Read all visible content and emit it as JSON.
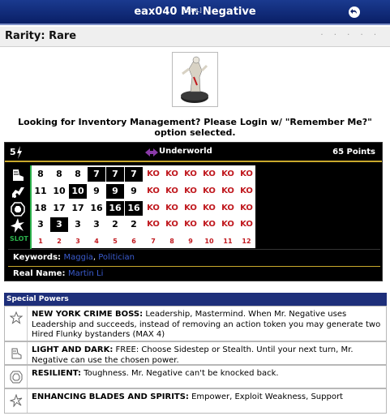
{
  "header": {
    "title": "eax040 Mr. Negative",
    "dial_label": "[DIAL]"
  },
  "rarity": {
    "text": "Rarity: Rare",
    "dots": "· · · · ·"
  },
  "notice": "Looking for Inventory Management? Please Login w/ \"Remember Me?\" option selected.",
  "card": {
    "point_prefix": "5",
    "team": "Underworld",
    "points": "65 Points",
    "dial_rows": [
      {
        "stat": "speed",
        "values": [
          "8",
          "8",
          "8",
          "7",
          "7",
          "7",
          "KO",
          "KO",
          "KO",
          "KO",
          "KO",
          "KO"
        ],
        "dark": [
          false,
          false,
          false,
          true,
          true,
          true,
          false,
          false,
          false,
          false,
          false,
          false
        ]
      },
      {
        "stat": "attack",
        "values": [
          "11",
          "10",
          "10",
          "9",
          "9",
          "9",
          "KO",
          "KO",
          "KO",
          "KO",
          "KO",
          "KO"
        ],
        "dark": [
          false,
          false,
          true,
          false,
          true,
          false,
          false,
          false,
          false,
          false,
          false,
          false
        ]
      },
      {
        "stat": "defense",
        "values": [
          "18",
          "17",
          "17",
          "16",
          "16",
          "16",
          "KO",
          "KO",
          "KO",
          "KO",
          "KO",
          "KO"
        ],
        "dark": [
          false,
          false,
          false,
          false,
          true,
          true,
          false,
          false,
          false,
          false,
          false,
          false
        ]
      },
      {
        "stat": "damage",
        "values": [
          "3",
          "3",
          "3",
          "3",
          "2",
          "2",
          "KO",
          "KO",
          "KO",
          "KO",
          "KO",
          "KO"
        ],
        "dark": [
          false,
          true,
          false,
          false,
          false,
          false,
          false,
          false,
          false,
          false,
          false,
          false
        ]
      }
    ],
    "slot_label": "SLOT",
    "clicks": [
      "1",
      "2",
      "3",
      "4",
      "5",
      "6",
      "7",
      "8",
      "9",
      "10",
      "11",
      "12"
    ],
    "keywords_label": "Keywords:",
    "keywords": [
      "Maggia",
      "Politician"
    ],
    "keyword_sep": ", ",
    "realname_label": "Real Name:",
    "realname": "Martin Li"
  },
  "special_powers": {
    "title": "Special Powers",
    "items": [
      {
        "icon": "star-icon",
        "name": "NEW YORK CRIME BOSS:",
        "desc": " Leadership, Mastermind. When Mr. Negative uses Leadership and succeeds, instead of removing an action token you may generate two Hired Flunky bystanders (MAX 4)"
      },
      {
        "icon": "speed-boot-icon",
        "name": "LIGHT AND DARK:",
        "desc": " FREE: Choose Sidestep or Stealth. Until your next turn, Mr. Negative can use the chosen power."
      },
      {
        "icon": "shield-icon",
        "name": "RESILIENT:",
        "desc": " Toughness. Mr. Negative can't be knocked back."
      },
      {
        "icon": "burst-icon",
        "name": "ENHANCING BLADES AND SPIRITS:",
        "desc": " Empower, Exploit Weakness, Support"
      }
    ]
  }
}
